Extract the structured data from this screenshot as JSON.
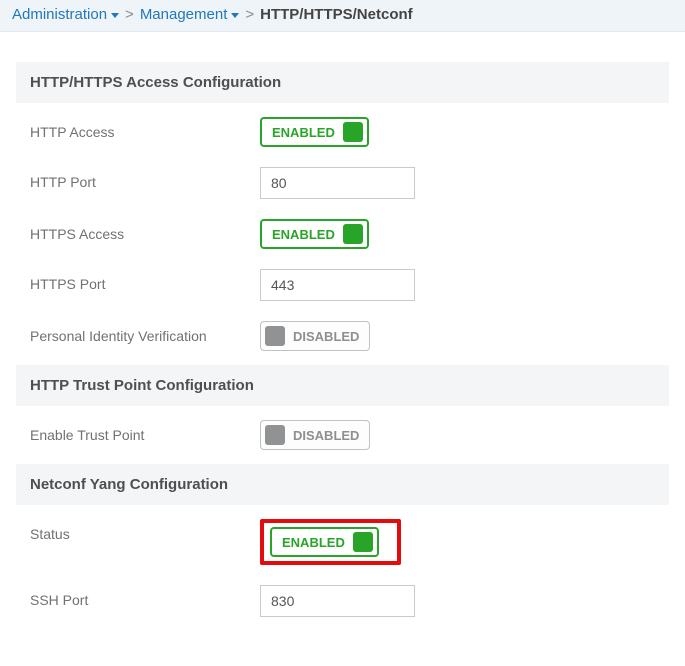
{
  "breadcrumb": {
    "item1": "Administration",
    "item2": "Management",
    "current": "HTTP/HTTPS/Netconf"
  },
  "sections": {
    "httpAccess": {
      "title": "HTTP/HTTPS Access Configuration",
      "rows": {
        "httpAccess": {
          "label": "HTTP Access",
          "status": "ENABLED"
        },
        "httpPort": {
          "label": "HTTP Port",
          "value": "80"
        },
        "httpsAccess": {
          "label": "HTTPS Access",
          "status": "ENABLED"
        },
        "httpsPort": {
          "label": "HTTPS Port",
          "value": "443"
        },
        "piv": {
          "label": "Personal Identity Verification",
          "status": "DISABLED"
        }
      }
    },
    "trustPoint": {
      "title": "HTTP Trust Point Configuration",
      "rows": {
        "enableTrustPoint": {
          "label": "Enable Trust Point",
          "status": "DISABLED"
        }
      }
    },
    "netconf": {
      "title": "Netconf Yang Configuration",
      "rows": {
        "status": {
          "label": "Status",
          "status": "ENABLED"
        },
        "sshPort": {
          "label": "SSH Port",
          "value": "830"
        }
      }
    }
  }
}
